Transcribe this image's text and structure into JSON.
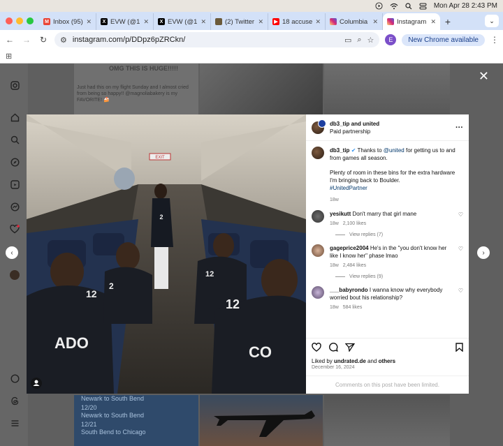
{
  "menubar": {
    "datetime": "Mon Apr 28  2:43 PM"
  },
  "tabs": [
    {
      "label": "Inbox (95)",
      "fav": "M",
      "color": "#ea4335"
    },
    {
      "label": "EVW (@1",
      "fav": "X",
      "color": "#000000"
    },
    {
      "label": "EVW (@1",
      "fav": "X",
      "color": "#000000"
    },
    {
      "label": "(2) Twitter",
      "fav": "T",
      "color": "#444444"
    },
    {
      "label": "18 accuse",
      "fav": "▶",
      "color": "#ff0000"
    },
    {
      "label": "Columbia",
      "fav": "◎",
      "color": "#d6249f"
    },
    {
      "label": "Instagram",
      "fav": "◎",
      "color": "#d6249f"
    }
  ],
  "address": {
    "url": "instagram.com/p/DDpz6pZRCkn/",
    "new_chrome": "New Chrome available",
    "profile_initial": "E"
  },
  "background": {
    "omg_text": "OMG THIS IS HUGE!!!!!",
    "caption": "Just had this on my flight Sunday and I almost cried from being so happy!! @magnoliabakery is my FAVORITE! 🍰",
    "routes": [
      "Newark to South Bend",
      "12/20",
      "Newark to South Bend",
      "12/21",
      "South Bend to Chicago"
    ]
  },
  "post": {
    "header_user": "db3_tip and united",
    "header_sub": "Paid partnership",
    "caption_user": "db3_tip",
    "caption_pre": "Thanks to ",
    "caption_mention": "@united",
    "caption_post": " for getting us to and from games all season.",
    "caption_p2": "Plenty of room in these bins for the extra hardware I'm bringing back to Boulder.",
    "caption_tag": "#UnitedPartner",
    "caption_age": "18w",
    "exit_sign": "EXIT",
    "comments": [
      {
        "user": "yesikutt",
        "text": "Don't marry that girl mane",
        "age": "18w",
        "likes": "2,100 likes",
        "replies": "View replies (7)"
      },
      {
        "user": "gageprice2004",
        "text": "He's in the \"you don't know her like I know her\" phase lmao",
        "age": "18w",
        "likes": "2,484 likes",
        "replies": "View replies (9)"
      },
      {
        "user": "___babyrondo",
        "text": "I wanna know why everybody worried bout his relationship?",
        "age": "18w",
        "likes": "584 likes"
      }
    ],
    "liked_by_pre": "Liked by ",
    "liked_by_user": "undrated.de",
    "liked_by_and": " and ",
    "liked_by_others": "others",
    "date": "December 16, 2024",
    "comments_disabled": "Comments on this post have been limited."
  }
}
